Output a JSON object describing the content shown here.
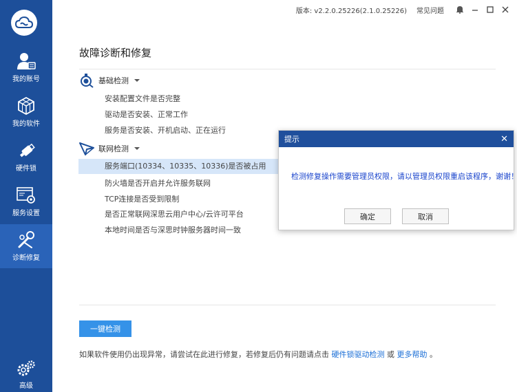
{
  "titlebar": {
    "version": "版本: v2.2.0.25226(2.1.0.25226)",
    "faq": "常见问题"
  },
  "sidebar": {
    "items": [
      {
        "label": "我的账号",
        "icon": "user-icon"
      },
      {
        "label": "我的软件",
        "icon": "cubes-icon"
      },
      {
        "label": "硬件锁",
        "icon": "usb-icon"
      },
      {
        "label": "服务设置",
        "icon": "settings-window-icon"
      },
      {
        "label": "诊断修复",
        "icon": "wrench-icon"
      },
      {
        "label": "高级",
        "icon": "gears-icon"
      }
    ]
  },
  "main": {
    "title": "故障诊断和修复",
    "basic": {
      "label": "基础检测",
      "items": [
        "安装配置文件是否完整",
        "驱动是否安装、正常工作",
        "服务是否安装、开机启动、正在运行"
      ]
    },
    "network": {
      "label": "联网检测",
      "items": [
        "服务端口(10334、10335、10336)是否被占用",
        "防火墙是否开启并允许服务联网",
        "TCP连接是否受到限制",
        "是否正常联网深思云用户中心/云许可平台",
        "本地时间是否与深思时钟服务器时间一致"
      ]
    },
    "check_button": "一键检测",
    "footer": {
      "text": "如果软件使用仍出现异常，请尝试在此进行修复，若修复后仍有问题请点击",
      "link1": "硬件锁驱动检测",
      "or": "或",
      "link2": "更多帮助",
      "end": "。"
    }
  },
  "dialog": {
    "title": "提示",
    "message": "检测修复操作需要管理员权限，请以管理员权限重启该程序，谢谢！",
    "ok": "确定",
    "cancel": "取消"
  },
  "colors": {
    "sidebar": "#1d4f9a",
    "accent": "#3592e8",
    "dialog_header": "#1f4f9c",
    "link": "#1a6ed6"
  }
}
